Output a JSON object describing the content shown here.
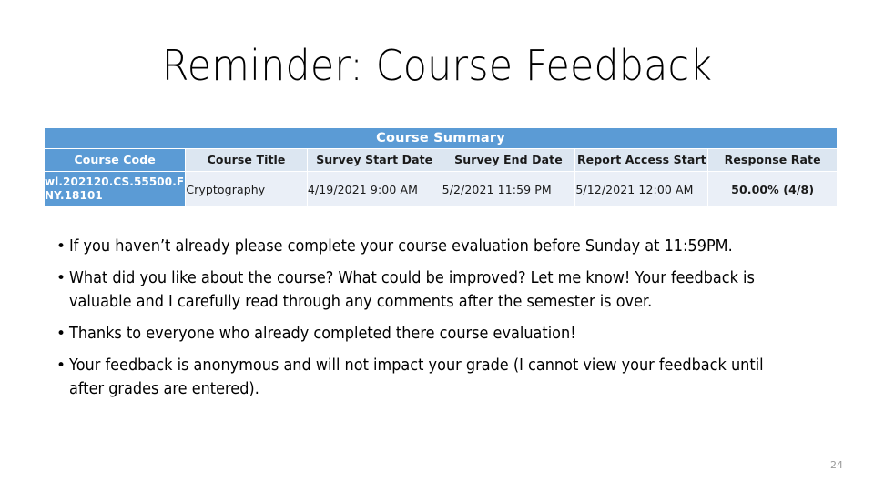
{
  "slide": {
    "title": "Reminder: Course Feedback",
    "page_number": "24"
  },
  "table": {
    "banner": "Course Summary",
    "columns": [
      "Course Code",
      "Course Title",
      "Survey Start Date",
      "Survey End Date",
      "Report Access Start",
      "Response Rate"
    ],
    "rows": [
      {
        "course_code": "wl.202120.CS.55500.FNY.18101",
        "course_title": "Cryptography",
        "survey_start_date": "4/19/2021 9:00 AM",
        "survey_end_date": "5/2/2021 11:59 PM",
        "report_access_start": "5/12/2021 12:00 AM",
        "response_rate": "50.00% (4/8)"
      }
    ],
    "colors": {
      "banner_background": "#5B9BD5",
      "header_background": "#DCE6F1",
      "cell_background": "#EAEFF7",
      "accent_column_background": "#5B9BD5"
    }
  },
  "bullets": {
    "marker": "•",
    "items": [
      "If you haven’t already please complete your course evaluation before Sunday at 11:59PM.",
      "What did you like about the course? What could be improved? Let me know! Your feedback is valuable and I carefully read through any comments after the semester is over.",
      "Thanks to everyone who already completed there course evaluation!",
      "Your feedback is anonymous and will not impact your grade (I cannot view your feedback until after grades are entered)."
    ]
  }
}
